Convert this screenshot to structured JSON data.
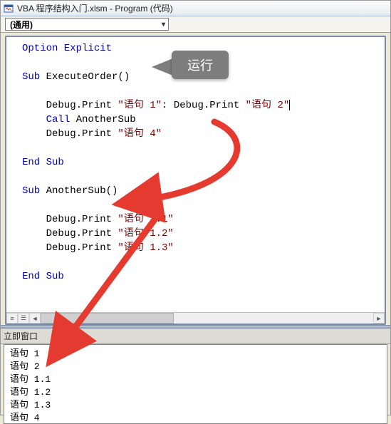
{
  "window": {
    "title": "VBA 程序结构入门.xlsm - Program (代码)"
  },
  "dropdown": {
    "selected": "(通用)"
  },
  "code": {
    "l1": "Option Explicit",
    "l2_sub": "Sub",
    "l2_name": " ExecuteOrder()",
    "l3_a": "    Debug.Print ",
    "l3_s1": "\"语句 1\"",
    "l3_b": ": Debug.Print ",
    "l3_s2": "\"语句 2\"",
    "l4_a": "    ",
    "l4_kw": "Call",
    "l4_b": " AnotherSub",
    "l5_a": "    Debug.Print ",
    "l5_s": "\"语句 4\"",
    "l6": "End Sub",
    "l7_sub": "Sub",
    "l7_name": " AnotherSub()",
    "l8_a": "    Debug.Print ",
    "l8_s": "\"语句 1.1\"",
    "l9_a": "    Debug.Print ",
    "l9_s": "\"语句 1.2\"",
    "l10_a": "    Debug.Print ",
    "l10_s": "\"语句 1.3\"",
    "l11": "End Sub"
  },
  "callout": {
    "label": "运行"
  },
  "immediate": {
    "title": "立即窗口",
    "out1": "语句 1",
    "out2": "语句 2",
    "out3": "语句 1.1",
    "out4": "语句 1.2",
    "out5": "语句 1.3",
    "out6": "语句 4"
  },
  "views": {
    "full": "≡",
    "proc": "☰"
  }
}
